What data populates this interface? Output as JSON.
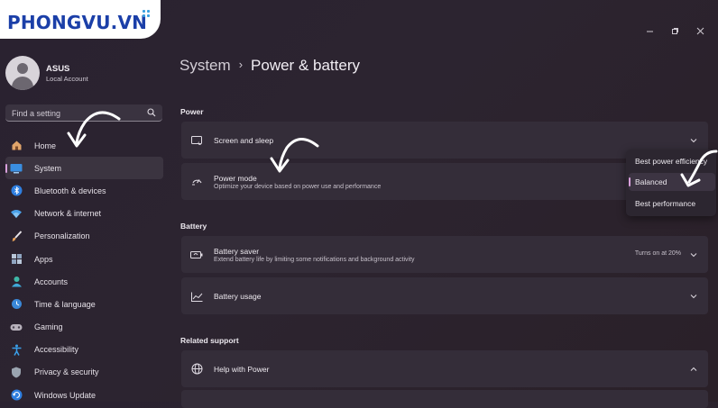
{
  "logo": {
    "text": "PHONGVU.VN"
  },
  "profile": {
    "name": "ASUS",
    "account_type": "Local Account"
  },
  "search": {
    "placeholder": "Find a setting"
  },
  "nav": {
    "items": [
      {
        "label": "Home",
        "icon": "home-icon"
      },
      {
        "label": "System",
        "icon": "system-icon",
        "active": true
      },
      {
        "label": "Bluetooth & devices",
        "icon": "bluetooth-icon"
      },
      {
        "label": "Network & internet",
        "icon": "wifi-icon"
      },
      {
        "label": "Personalization",
        "icon": "brush-icon"
      },
      {
        "label": "Apps",
        "icon": "apps-icon"
      },
      {
        "label": "Accounts",
        "icon": "accounts-icon"
      },
      {
        "label": "Time & language",
        "icon": "globe-clock-icon"
      },
      {
        "label": "Gaming",
        "icon": "gamepad-icon"
      },
      {
        "label": "Accessibility",
        "icon": "accessibility-icon"
      },
      {
        "label": "Privacy & security",
        "icon": "shield-icon"
      },
      {
        "label": "Windows Update",
        "icon": "update-icon"
      }
    ]
  },
  "breadcrumb": {
    "parent": "System",
    "current": "Power & battery"
  },
  "sections": {
    "power": "Power",
    "battery": "Battery",
    "related": "Related support"
  },
  "cards": {
    "screen_sleep": {
      "title": "Screen and sleep"
    },
    "power_mode": {
      "title": "Power mode",
      "desc": "Optimize your device based on power use and performance"
    },
    "battery_saver": {
      "title": "Battery saver",
      "desc": "Extend battery life by limiting some notifications and background activity",
      "meta": "Turns on at 20%"
    },
    "battery_usage": {
      "title": "Battery usage"
    },
    "help_power": {
      "title": "Help with Power"
    }
  },
  "power_mode_dropdown": {
    "options": [
      "Best power efficiency",
      "Balanced",
      "Best performance"
    ],
    "selected": "Balanced"
  },
  "colors": {
    "accent": "#d9a0dc",
    "card_bg": "#342d39",
    "logo_blue": "#1b3fa8"
  }
}
